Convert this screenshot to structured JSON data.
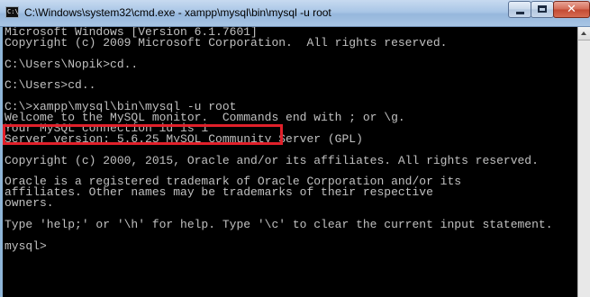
{
  "window": {
    "title": "C:\\Windows\\system32\\cmd.exe - xampp\\mysql\\bin\\mysql  -u root",
    "icon_text": "C:\\"
  },
  "caption_buttons": {
    "minimize": "minimize-icon",
    "maximize": "maximize-icon",
    "close": "close-icon"
  },
  "console": {
    "background": "#000000",
    "foreground": "#c0c0c0",
    "highlight_color": "#e0202a",
    "lines": [
      "Microsoft Windows [Version 6.1.7601]",
      "Copyright (c) 2009 Microsoft Corporation.  All rights reserved.",
      "",
      "C:\\Users\\Nopik>cd..",
      "",
      "C:\\Users>cd..",
      "",
      "C:\\>xampp\\mysql\\bin\\mysql -u root",
      "Welcome to the MySQL monitor.  Commands end with ; or \\g.",
      "Your MySQL connection id is 1",
      "Server version: 5.6.25 MySQL Community Server (GPL)",
      "",
      "Copyright (c) 2000, 2015, Oracle and/or its affiliates. All rights reserved.",
      "",
      "Oracle is a registered trademark of Oracle Corporation and/or its",
      "affiliates. Other names may be trademarks of their respective",
      "owners.",
      "",
      "Type 'help;' or '\\h' for help. Type '\\c' to clear the current input statement.",
      "",
      "mysql>"
    ]
  }
}
